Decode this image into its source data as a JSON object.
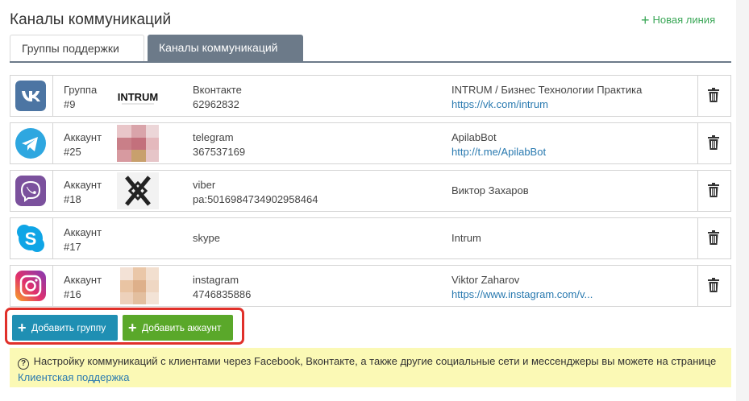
{
  "page": {
    "title": "Каналы коммуникаций",
    "new_line_label": "Новая линия"
  },
  "tabs": [
    {
      "label": "Группы поддержки",
      "active": false
    },
    {
      "label": "Каналы коммуникаций",
      "active": true
    }
  ],
  "channels": [
    {
      "icon": "vk-icon",
      "type": "Группа",
      "id": "#9",
      "thumb_text": "INTRUM",
      "account_name": "Вконтакте",
      "account_value": "62962832",
      "info_name": "INTRUM / Бизнес Технологии Практика",
      "info_link": "https://vk.com/intrum"
    },
    {
      "icon": "telegram-icon",
      "type": "Аккаунт",
      "id": "#25",
      "account_name": "telegram",
      "account_value": "367537169",
      "info_name": "ApilabBot",
      "info_link": "http://t.me/ApilabBot"
    },
    {
      "icon": "viber-icon",
      "type": "Аккаунт",
      "id": "#18",
      "account_name": "viber",
      "account_value": "pa:5016984734902958464",
      "info_name": "Виктор Захаров",
      "info_link": ""
    },
    {
      "icon": "skype-icon",
      "type": "Аккаунт",
      "id": "#17",
      "account_name": "skype",
      "account_value": "",
      "info_name": "Intrum",
      "info_link": ""
    },
    {
      "icon": "instagram-icon",
      "type": "Аккаунт",
      "id": "#16",
      "account_name": "instagram",
      "account_value": "4746835886",
      "info_name": "Viktor Zaharov",
      "info_link": "https://www.instagram.com/v..."
    }
  ],
  "buttons": {
    "add_group": "Добавить группу",
    "add_account": "Добавить аккаунт"
  },
  "note": {
    "text": "Настройку коммуникаций с клиентами через Facebook, Вконтакте, а также другие социальные сети и мессенджеры вы можете на странице",
    "link": "Клиентская поддержка"
  },
  "colors": {
    "tab_active": "#6c7a89",
    "add_group_button": "#1f8fb3",
    "add_account_button": "#5aa82a",
    "highlight_box": "#e0302a",
    "note_background": "#fbf9b5",
    "link": "#2a7ab0"
  }
}
